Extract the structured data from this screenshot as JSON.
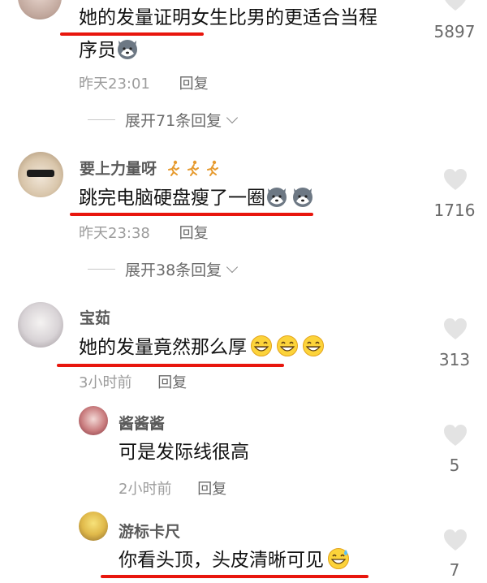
{
  "comments": [
    {
      "text_line1": "她的发量证明女生比男的更适合当程",
      "text_line2": "序员",
      "time": "昨天23:01",
      "reply": "回复",
      "expand": "展开71条回复",
      "likes": "5897"
    },
    {
      "user": "要上力量呀",
      "text": "跳完电脑硬盘瘦了一圈",
      "time": "昨天23:38",
      "reply": "回复",
      "expand": "展开38条回复",
      "likes": "1716"
    },
    {
      "user": "宝茹",
      "text": "她的发量竟然那么厚",
      "time": "3小时前",
      "reply": "回复",
      "likes": "313"
    }
  ],
  "replies": [
    {
      "user": "酱酱酱",
      "text": "可是发际线很高",
      "time": "2小时前",
      "reply": "回复",
      "likes": "5"
    },
    {
      "user": "游标卡尺",
      "text": "你看头顶，头皮清晰可见",
      "likes": "7"
    }
  ],
  "colors": {
    "underline": "#e8160d",
    "heart": "#e3e3e3",
    "meta": "#9c9c9c"
  },
  "icons": [
    "heart-icon",
    "husky-emoji",
    "grin-emoji",
    "sweat-smile-emoji",
    "runner-emoji",
    "chevron-down-icon"
  ]
}
